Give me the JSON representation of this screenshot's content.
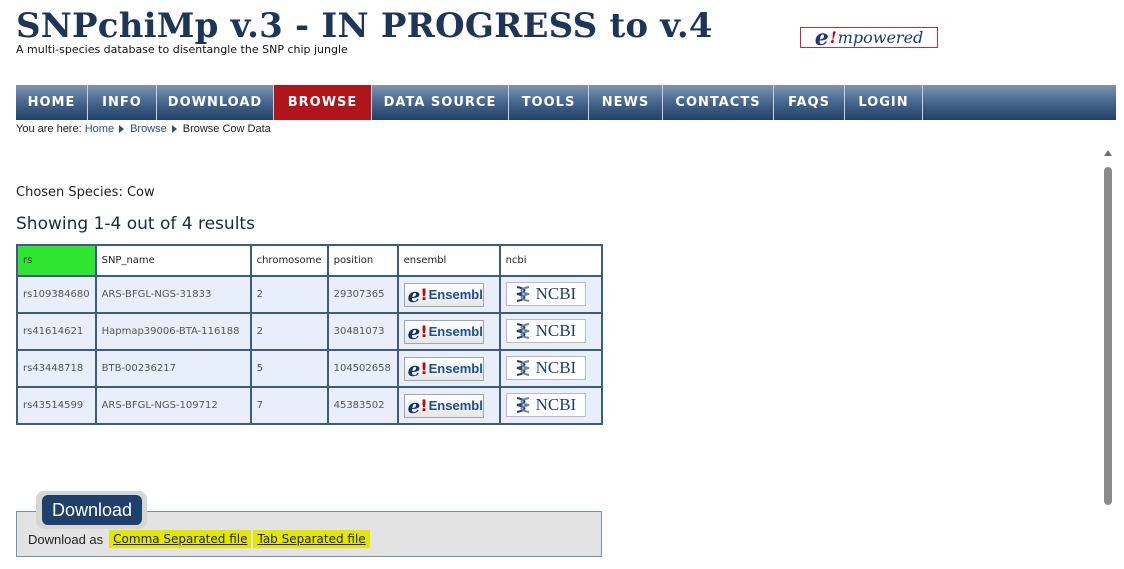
{
  "header": {
    "title": "SNPchiMp v.3 - IN PROGRESS to v.4",
    "subtitle": "A multi-species database to disentangle the SNP chip jungle",
    "logo_text": "mpowered"
  },
  "nav": {
    "items": [
      {
        "label": "HOME"
      },
      {
        "label": "INFO"
      },
      {
        "label": "DOWNLOAD"
      },
      {
        "label": "BROWSE"
      },
      {
        "label": "DATA SOURCE"
      },
      {
        "label": "TOOLS"
      },
      {
        "label": "NEWS"
      },
      {
        "label": "CONTACTS"
      },
      {
        "label": "FAQS"
      },
      {
        "label": "LOGIN"
      }
    ],
    "active": "BROWSE"
  },
  "breadcrumb": {
    "prefix": "You are here:",
    "home": "Home",
    "browse": "Browse",
    "current": "Browse Cow Data"
  },
  "species": {
    "label": "Chosen Species:",
    "value": "Cow"
  },
  "results": {
    "summary": "Showing 1-4 out of 4 results",
    "columns": [
      "rs",
      "SNP_name",
      "chromosome",
      "position",
      "ensembl",
      "ncbi"
    ],
    "rows": [
      {
        "rs": "rs109384680",
        "snp_name": "ARS-BFGL-NGS-31833",
        "chromosome": "2",
        "position": "29307365"
      },
      {
        "rs": "rs41614621",
        "snp_name": "Hapmap39006-BTA-116188",
        "chromosome": "2",
        "position": "30481073"
      },
      {
        "rs": "rs43448718",
        "snp_name": "BTB-00236217",
        "chromosome": "5",
        "position": "104502658"
      },
      {
        "rs": "rs43514599",
        "snp_name": "ARS-BFGL-NGS-109712",
        "chromosome": "7",
        "position": "45383502"
      }
    ],
    "ensembl_button": "Ensembl",
    "ncbi_button": "NCBI"
  },
  "download": {
    "title": "Download",
    "prefix": "Download as",
    "csv_link": "Comma Separated file",
    "tsv_link": "Tab Separated file"
  },
  "colors": {
    "nav_active": "#b0151c",
    "nav_bg": "#1f3f68",
    "rs_header_highlight": "#2ee62e",
    "link_highlight": "#e5e600"
  }
}
